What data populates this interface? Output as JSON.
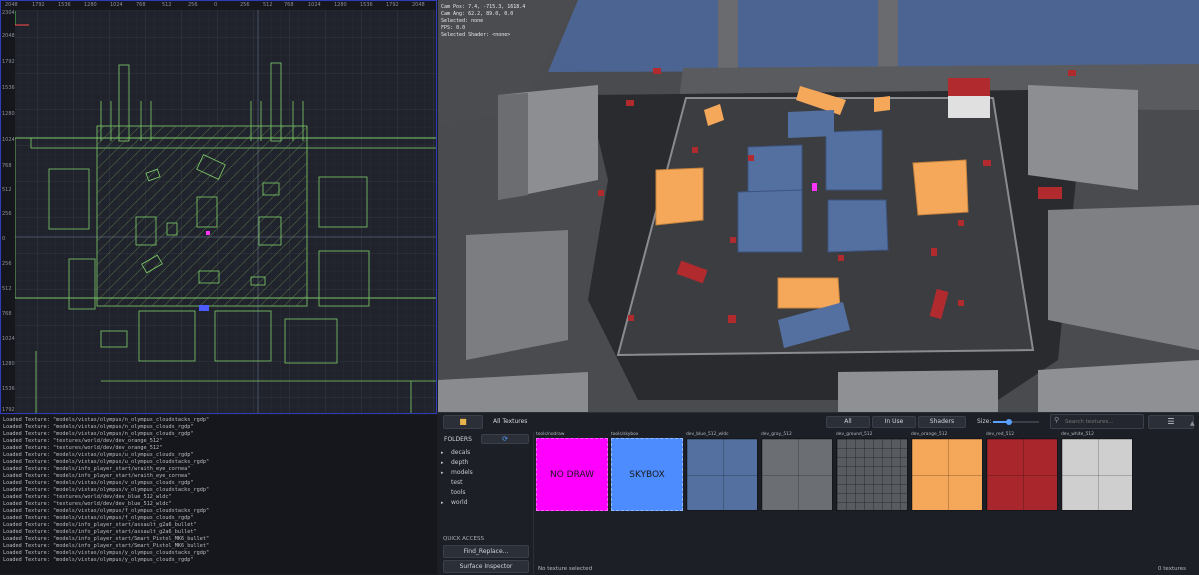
{
  "ruler": {
    "top": [
      "2048",
      "1792",
      "1536",
      "1280",
      "1024",
      "768",
      "512",
      "256",
      "0",
      "256",
      "512",
      "768",
      "1024",
      "1280",
      "1536",
      "1792",
      "2048"
    ],
    "left": [
      "2304",
      "2048",
      "1792",
      "1536",
      "1280",
      "1024",
      "768",
      "512",
      "256",
      "0",
      "256",
      "512",
      "768",
      "1024",
      "1280",
      "1536",
      "1792"
    ]
  },
  "viewport3d": {
    "cam_pos_label": "Cam Pos:",
    "cam_pos": "7.4,  -715.3,  1618.4",
    "cam_ang_label": "Cam Ang:",
    "cam_ang": "62.2,  89.0,  0.0",
    "selected_label": "Selected:",
    "selected": "none",
    "fps_label": "FPS:",
    "fps": "0.0",
    "selected_shader_label": "Selected Shader:",
    "selected_shader": "<none>"
  },
  "console": {
    "lines": [
      "Loaded Texture: \"models/vistas/olympus/n_olympus_cloudstacks_rgdp\"",
      "Loaded Texture: \"models/vistas/olympus/n_olympus_clouds_rgdp\"",
      "Loaded Texture: \"models/vistas/olympus/n_olympus_clouds_rgdp\"",
      "Loaded Texture: \"textures/world/dev/dev_orange_512\"",
      "Loaded Texture: \"textures/world/dev/dev_orange_512\"",
      "Loaded Texture: \"models/vistas/olympus/u_olympus_clouds_rgdp\"",
      "Loaded Texture: \"models/vistas/olympus/u_olympus_cloudstacks_rgdp\"",
      "Loaded Texture: \"models/info_player_start/wraith_eye_cornea\"",
      "Loaded Texture: \"models/info_player_start/wraith_eye_cornea\"",
      "Loaded Texture: \"models/vistas/olympus/v_olympus_clouds_rgdp\"",
      "Loaded Texture: \"models/vistas/olympus/v_olympus_cloudstacks_rgdp\"",
      "Loaded Texture: \"textures/world/dev/dev_blue_512_wldc\"",
      "Loaded Texture: \"textures/world/dev/dev_blue_512_wldc\"",
      "Loaded Texture: \"models/vistas/olympus/f_olympus_cloudstacks_rgdp\"",
      "Loaded Texture: \"models/vistas/olympus/f_olympus_clouds_rgdp\"",
      "Loaded Texture: \"models/info_player_start/assault_g2a6_bullet\"",
      "Loaded Texture: \"models/info_player_start/assault_g2a6_bullet\"",
      "Loaded Texture: \"models/info_player_start/Smart_Pistol_MK6_bullet\"",
      "Loaded Texture: \"models/info_player_start/Smart_Pistol_MK6_bullet\"",
      "Loaded Texture: \"models/vistas/olympus/y_olympus_cloudstacks_rgdp\"",
      "Loaded Texture: \"models/vistas/olympus/y_olympus_clouds_rgdp\""
    ]
  },
  "browser": {
    "all_textures": "All Textures",
    "filters": [
      "All",
      "In Use",
      "Shaders"
    ],
    "size_label": "Size:",
    "size_value": 0.35,
    "search_placeholder": "Search textures...",
    "folders_label": "FOLDERS",
    "folders": [
      "decals",
      "depth",
      "models",
      "test",
      "tools",
      "world"
    ],
    "folder_has_children": [
      true,
      true,
      true,
      false,
      false,
      true
    ],
    "quick_access_label": "QUICK ACCESS",
    "find_replace": "Find_Replace...",
    "surface_inspector": "Surface Inspector",
    "status_left": "No texture selected",
    "status_right": "0 textures",
    "tiles": [
      {
        "name": "tools/nodraw",
        "text": "NO DRAW",
        "color": "#ff00ff"
      },
      {
        "name": "tools/skybox",
        "text": "SKYBOX",
        "color": "#4d8cff"
      },
      {
        "name": "dev_blue_512_wldc",
        "text": "",
        "color": "#5470a0"
      },
      {
        "name": "dev_gray_512",
        "text": "",
        "color": "#6b6e72"
      },
      {
        "name": "dev_ground_512",
        "text": "",
        "color": "#585b5f"
      },
      {
        "name": "dev_orange_512",
        "text": "",
        "color": "#f5a85a"
      },
      {
        "name": "dev_red_512",
        "text": "",
        "color": "#a8262c"
      },
      {
        "name": "dev_white_512",
        "text": "",
        "color": "#cfcfcf"
      }
    ]
  }
}
